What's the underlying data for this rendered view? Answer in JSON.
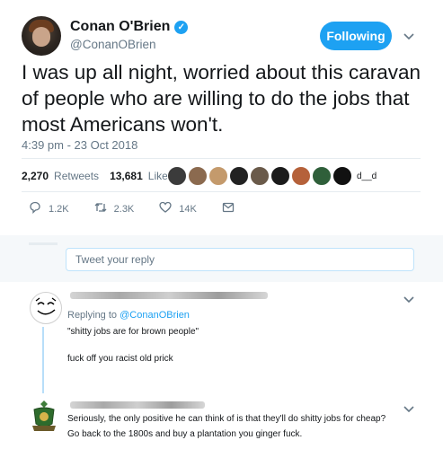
{
  "author": {
    "name": "Conan O'Brien",
    "handle": "@ConanOBrien",
    "verified_glyph": "✓"
  },
  "follow_label": "Following",
  "tweet": {
    "text": "I was up all night, worried about this caravan of people who are willing to do the jobs that most Americans won't.",
    "timestamp": "4:39 pm - 23 Oct 2018"
  },
  "stats": {
    "retweets_count": "2,270",
    "retweets_label": "Retweets",
    "likes_count": "13,681",
    "likes_label": "Likes",
    "more_likers": "d__d"
  },
  "actions": {
    "replies": "1.2K",
    "retweets": "2.3K",
    "likes": "14K"
  },
  "reply_box": {
    "placeholder": "Tweet your reply"
  },
  "replies": [
    {
      "replying_to_prefix": "Replying to",
      "replying_to_mention": "@ConanOBrien",
      "lines": [
        "\"shitty jobs are for brown people\"",
        "fuck off you racist old prick"
      ]
    },
    {
      "lines": [
        "Seriously, the only positive he can think of is that they'll do shitty jobs for cheap?",
        "Go back to the 1800s and buy a plantation you ginger fuck."
      ]
    }
  ],
  "colors": {
    "accent": "#1da1f2",
    "muted": "#657786",
    "text": "#14171a"
  },
  "icons": [
    "verified-icon",
    "chevron-down-icon",
    "reply-icon",
    "retweet-icon",
    "like-icon",
    "direct-message-icon"
  ]
}
